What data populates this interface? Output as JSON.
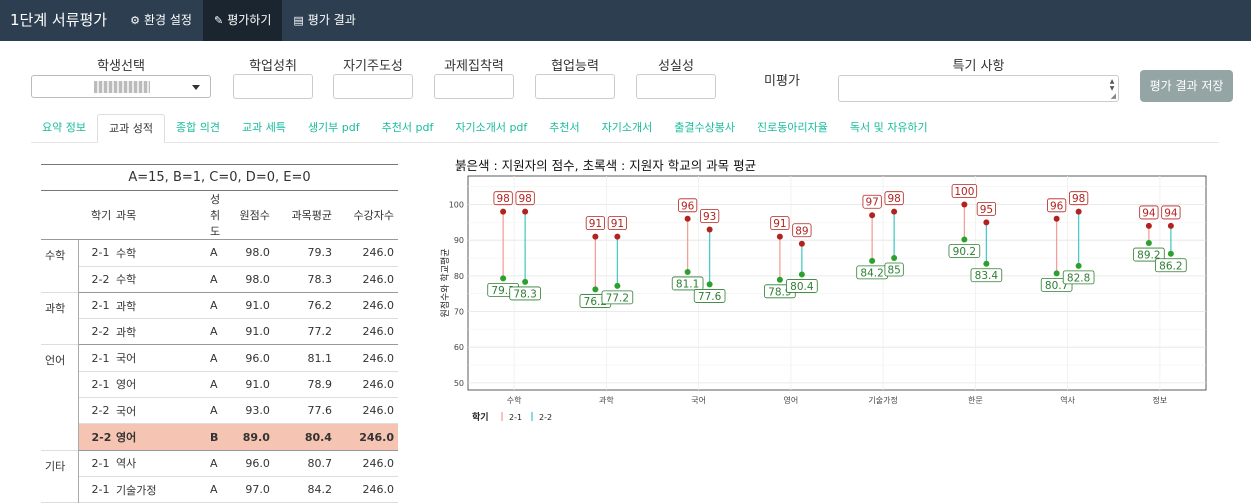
{
  "navbar": {
    "brand": "1단계 서류평가",
    "items": [
      {
        "label": "환경 설정",
        "icon": "gears-icon",
        "active": false
      },
      {
        "label": "평가하기",
        "icon": "edit-icon",
        "active": true
      },
      {
        "label": "평가 결과",
        "icon": "file-icon",
        "active": false
      }
    ]
  },
  "form": {
    "student_label": "학생선택",
    "fields": [
      "학업성취",
      "자기주도성",
      "과제집착력",
      "협업능력",
      "성실성"
    ],
    "unrated": "미평가",
    "remarks_label": "특기 사항",
    "save_label": "평가 결과 저장"
  },
  "tabs": [
    "요약 정보",
    "교과 성적",
    "종합 의견",
    "교과 세특",
    "생기부 pdf",
    "추천서 pdf",
    "자기소개서 pdf",
    "추천서",
    "자기소개서",
    "출결수상봉사",
    "진로동아리자율",
    "독서 및 자유하기"
  ],
  "active_tab": 1,
  "table": {
    "caption": "A=15, B=1, C=0, D=0, E=0",
    "headers": [
      "",
      "학기",
      "과목",
      "성취도",
      "원점수",
      "과목평균",
      "수강자수"
    ],
    "rows": [
      {
        "group": "수학",
        "sem": "2-1",
        "subj": "수학",
        "ach": "A",
        "score": "98.0",
        "avg": "79.3",
        "n": "246.0"
      },
      {
        "group": "",
        "sem": "2-2",
        "subj": "수학",
        "ach": "A",
        "score": "98.0",
        "avg": "78.3",
        "n": "246.0"
      },
      {
        "group": "과학",
        "sem": "2-1",
        "subj": "과학",
        "ach": "A",
        "score": "91.0",
        "avg": "76.2",
        "n": "246.0"
      },
      {
        "group": "",
        "sem": "2-2",
        "subj": "과학",
        "ach": "A",
        "score": "91.0",
        "avg": "77.2",
        "n": "246.0"
      },
      {
        "group": "언어",
        "sem": "2-1",
        "subj": "국어",
        "ach": "A",
        "score": "96.0",
        "avg": "81.1",
        "n": "246.0"
      },
      {
        "group": "",
        "sem": "2-1",
        "subj": "영어",
        "ach": "A",
        "score": "91.0",
        "avg": "78.9",
        "n": "246.0"
      },
      {
        "group": "",
        "sem": "2-2",
        "subj": "국어",
        "ach": "A",
        "score": "93.0",
        "avg": "77.6",
        "n": "246.0"
      },
      {
        "group": "",
        "sem": "2-2",
        "subj": "영어",
        "ach": "B",
        "score": "89.0",
        "avg": "80.4",
        "n": "246.0"
      },
      {
        "group": "기타",
        "sem": "2-1",
        "subj": "역사",
        "ach": "A",
        "score": "96.0",
        "avg": "80.7",
        "n": "246.0"
      },
      {
        "group": "",
        "sem": "2-1",
        "subj": "기술가정",
        "ach": "A",
        "score": "97.0",
        "avg": "84.2",
        "n": "246.0"
      }
    ]
  },
  "chart_title": "붉은색 : 지원자의 점수, 초록색 : 지원자 학교의 과목 평균",
  "chart_data": {
    "type": "dumbbell",
    "title": "붉은색 : 지원자의 점수, 초록색 : 지원자 학교의 과목 평균",
    "ylabel": "원점수와 학교평균",
    "ylim": [
      48,
      108
    ],
    "yticks": [
      50,
      60,
      70,
      80,
      90,
      100
    ],
    "categories": [
      "수학",
      "과학",
      "국어",
      "영어",
      "기술가정",
      "한문",
      "역사",
      "정보"
    ],
    "legend_title": "학기",
    "legend_position": "bottom-left",
    "series": [
      {
        "name": "2-1",
        "color": "#f4a09a",
        "score": [
          98,
          91,
          96,
          91,
          97,
          100,
          96,
          94
        ],
        "avg": [
          79.3,
          76.2,
          81.1,
          78.9,
          84.2,
          90.2,
          80.7,
          89.2
        ]
      },
      {
        "name": "2-2",
        "color": "#4cc9c9",
        "score": [
          98,
          91,
          93,
          89,
          98,
          95,
          98,
          94
        ],
        "avg": [
          78.3,
          77.2,
          77.6,
          80.4,
          85,
          83.4,
          82.8,
          86.2
        ]
      }
    ],
    "score_color": "#b2231f",
    "avg_color": "#2ca02c"
  }
}
